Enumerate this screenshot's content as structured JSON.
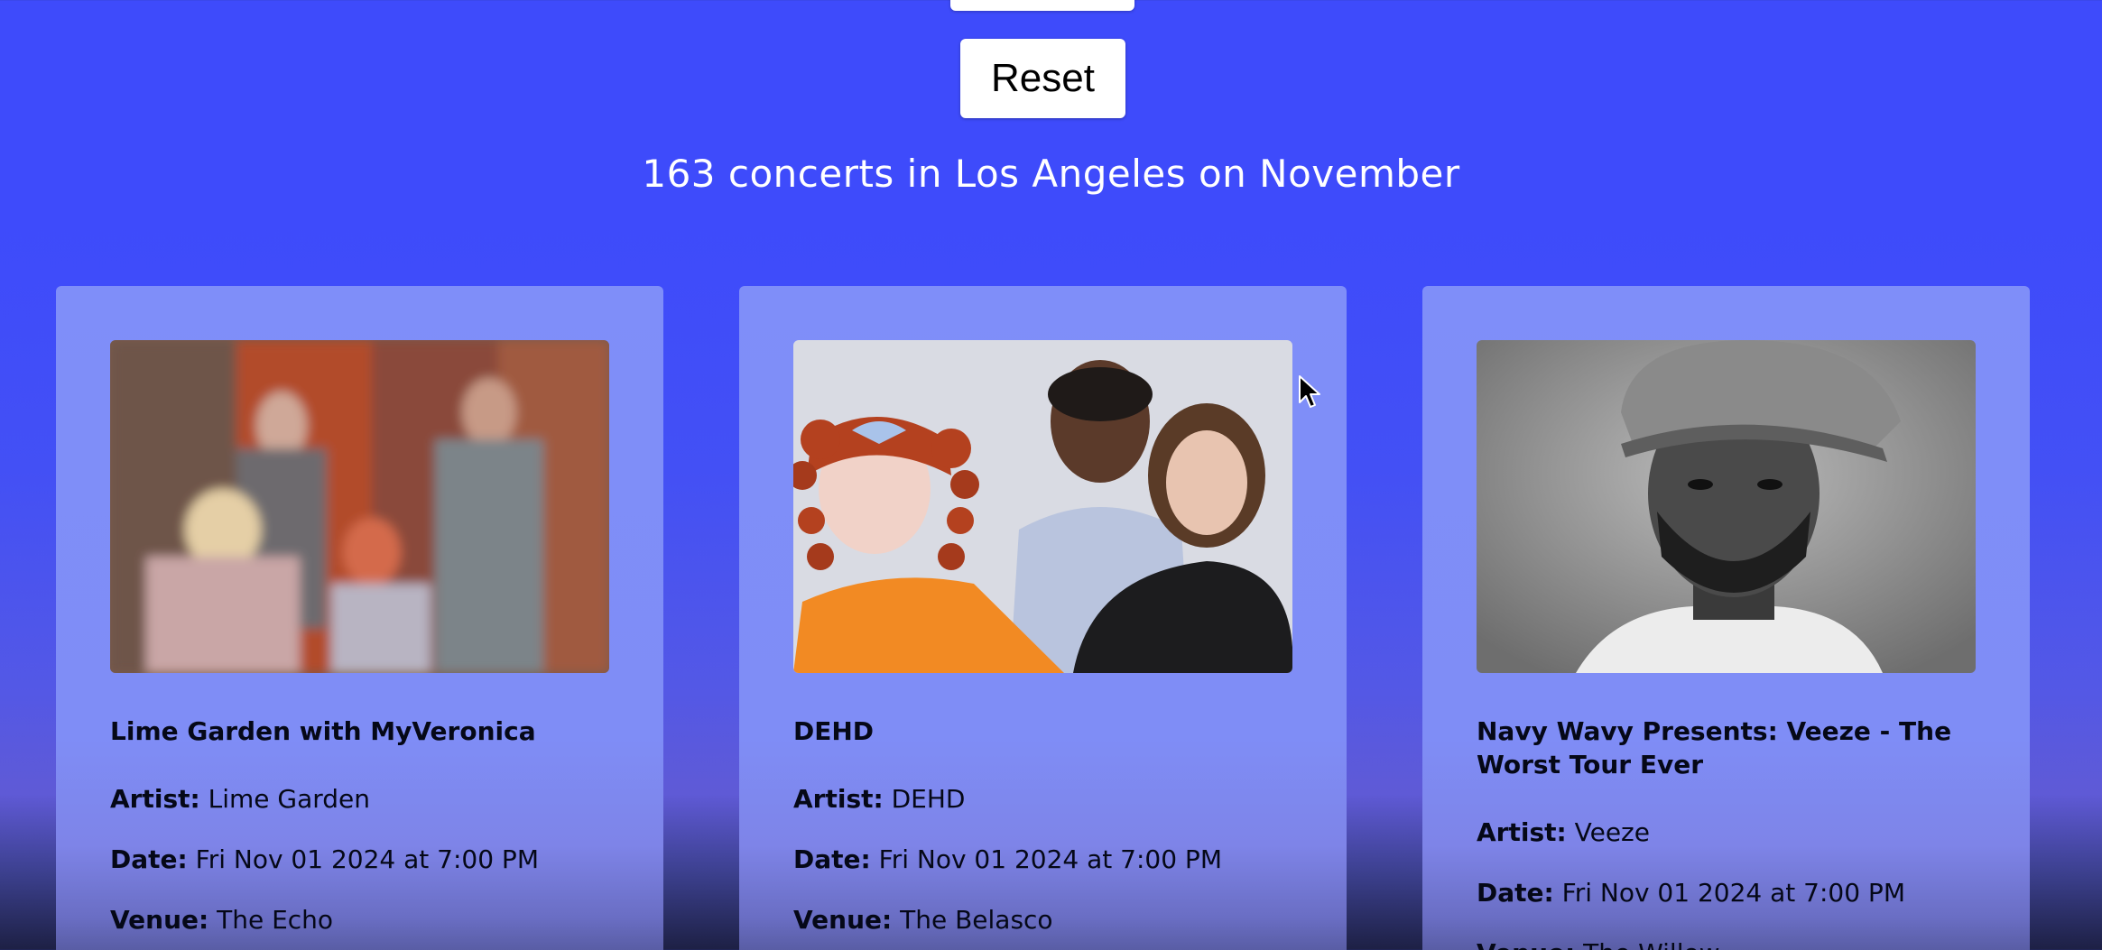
{
  "controls": {
    "reset_label": "Reset"
  },
  "results": {
    "heading": "163 concerts in Los Angeles on November"
  },
  "labels": {
    "artist": "Artist:",
    "date": "Date:",
    "venue": "Venue:"
  },
  "cards": [
    {
      "title": "Lime Garden with MyVeronica",
      "artist": "Lime Garden",
      "date": "Fri Nov 01 2024 at 7:00 PM",
      "venue": "The Echo",
      "image": "band-photo"
    },
    {
      "title": "DEHD",
      "artist": "DEHD",
      "date": "Fri Nov 01 2024 at 7:00 PM",
      "venue": "The Belasco",
      "image": "band-photo"
    },
    {
      "title": "Navy Wavy Presents: Veeze - The Worst Tour Ever",
      "artist": "Veeze",
      "date": "Fri Nov 01 2024 at 7:00 PM",
      "venue": "The Willow",
      "image": "artist-portrait"
    }
  ],
  "colors": {
    "page_background": "#3e4bfb",
    "card_background": "#7f8ef9",
    "text": "#050817",
    "button_background": "#ffffff"
  }
}
